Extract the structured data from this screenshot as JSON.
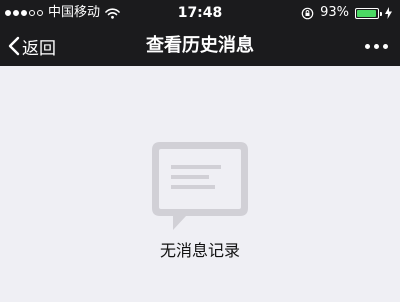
{
  "status_bar": {
    "carrier": "中国移动",
    "time": "17:48",
    "battery_percent": "93%",
    "battery_level": 0.93
  },
  "nav": {
    "back_label": "返回",
    "title": "查看历史消息"
  },
  "empty_state": {
    "message": "无消息记录"
  },
  "colors": {
    "bar_background": "#1b1b1d",
    "page_background": "#efeff4",
    "battery_green": "#4cd964",
    "icon_gray": "#d1d0d6"
  }
}
